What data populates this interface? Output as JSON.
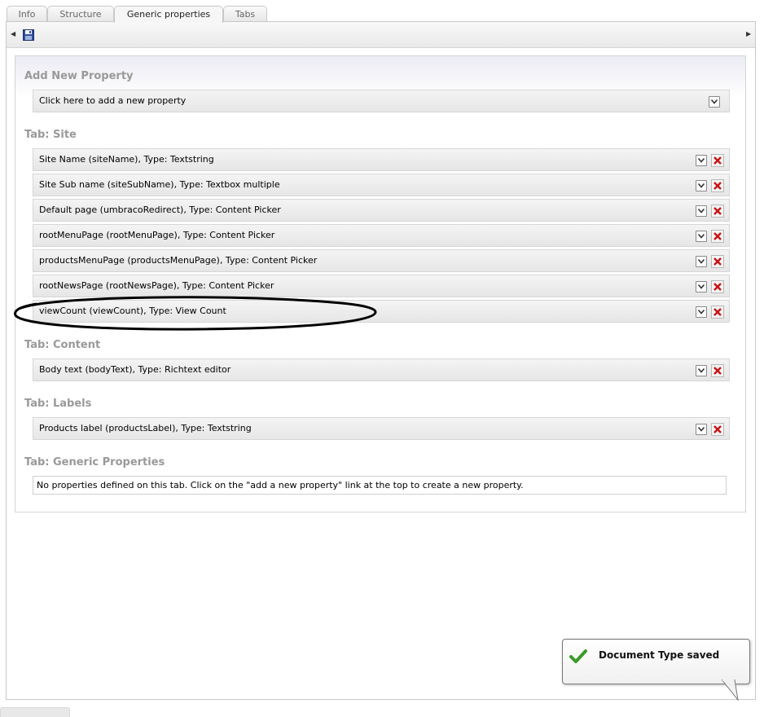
{
  "tabs": [
    {
      "label": "Info"
    },
    {
      "label": "Structure"
    },
    {
      "label": "Generic properties"
    },
    {
      "label": "Tabs"
    }
  ],
  "active_tab": "Generic properties",
  "toolbar": {
    "icons": [
      "scroll-left-icon",
      "save-icon",
      "scroll-right-icon"
    ]
  },
  "add_section": {
    "title": "Add New Property",
    "row_label": "Click here to add a new property"
  },
  "groups": {
    "site": {
      "title": "Tab: Site",
      "rows": [
        {
          "label": "Site Name (siteName), Type: Textstring"
        },
        {
          "label": "Site Sub name (siteSubName), Type: Textbox multiple"
        },
        {
          "label": "Default page (umbracoRedirect), Type: Content Picker"
        },
        {
          "label": "rootMenuPage (rootMenuPage), Type: Content Picker"
        },
        {
          "label": "productsMenuPage (productsMenuPage), Type: Content Picker"
        },
        {
          "label": "rootNewsPage (rootNewsPage), Type: Content Picker"
        },
        {
          "label": "viewCount (viewCount), Type: View Count"
        }
      ]
    },
    "content": {
      "title": "Tab: Content",
      "rows": [
        {
          "label": "Body text (bodyText), Type: Richtext editor"
        }
      ]
    },
    "labels": {
      "title": "Tab: Labels",
      "rows": [
        {
          "label": "Products label (productsLabel), Type: Textstring"
        }
      ]
    },
    "generic": {
      "title": "Tab: Generic Properties",
      "empty_message": "No properties defined on this tab. Click on the \"add a new property\" link at the top to create a new property."
    }
  },
  "toast": {
    "message": "Document Type saved"
  },
  "colors": {
    "section_title": "#999999",
    "delete_red": "#cc1111",
    "highlight_ellipse": "#000000",
    "save_icon_blue": "#2c4f9e"
  }
}
